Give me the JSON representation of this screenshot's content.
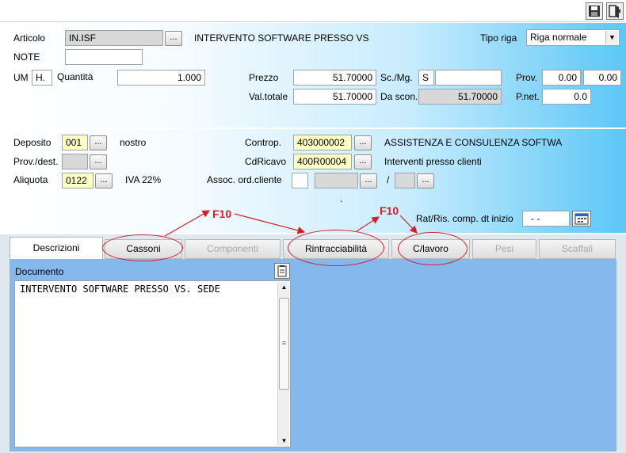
{
  "toolbar": {
    "save_icon": "save-icon",
    "exit_icon": "exit-door-icon"
  },
  "header": {
    "articolo_label": "Articolo",
    "articolo_value": "IN.ISF",
    "articolo_description": "INTERVENTO SOFTWARE PRESSO VS",
    "tipo_riga_label": "Tipo riga",
    "tipo_riga_value": "Riga normale",
    "note_label": "NOTE",
    "note_value": "",
    "um_label": "UM",
    "um_value": "H.",
    "quantita_label": "Quantità",
    "quantita_value": "1.000",
    "prezzo_label": "Prezzo",
    "prezzo_value": "51.70000",
    "sc_mg_label": "Sc./Mg.",
    "sc_mg_value": "S",
    "sc_mg_value2": "",
    "prov_label": "Prov.",
    "prov_value1": "0.00",
    "prov_value2": "0.00",
    "val_totale_label": "Val.totale",
    "val_totale_value": "51.70000",
    "da_scon_label": "Da scon.",
    "da_scon_value": "51.70000",
    "pnet_label": "P.net.",
    "pnet_value": "0.0"
  },
  "details": {
    "deposito_label": "Deposito",
    "deposito_value": "001",
    "deposito_desc": "nostro",
    "prov_dest_label": "Prov./dest.",
    "prov_dest_value": "",
    "aliquota_label": "Aliquota",
    "aliquota_value": "0122",
    "aliquota_desc": "IVA 22%",
    "controp_label": "Controp.",
    "controp_value": "403000002",
    "controp_desc": "ASSISTENZA E CONSULENZA SOFTWA",
    "cdricavo_label": "CdRicavo",
    "cdricavo_value": "400R00004",
    "cdricavo_desc": "Interventi presso clienti",
    "assoc_label": "Assoc. ord.cliente",
    "assoc_sep": "/",
    "dot": ".",
    "rat_label": "Rat/Ris. comp. dt inizio",
    "rat_value": "- -"
  },
  "dots_label": "...",
  "tabs": [
    {
      "label": "Descrizioni"
    },
    {
      "label": "Cassoni"
    },
    {
      "label": "Componenti"
    },
    {
      "label": "Rintracciabilità"
    },
    {
      "label": "C/lavoro"
    },
    {
      "label": "Pesi"
    },
    {
      "label": "Scaffali"
    }
  ],
  "document": {
    "label": "Documento",
    "text": "INTERVENTO SOFTWARE PRESSO VS. SEDE"
  },
  "annotations": {
    "f10_a": "F10",
    "f10_b": "F10"
  },
  "scroll_grip": "≡"
}
